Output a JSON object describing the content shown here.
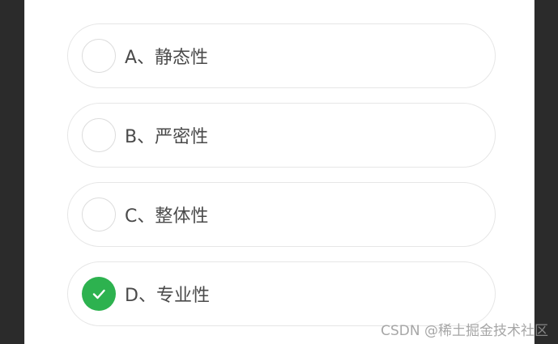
{
  "options": [
    {
      "label": "A、静态性",
      "checked": false
    },
    {
      "label": "B、严密性",
      "checked": false
    },
    {
      "label": "C、整体性",
      "checked": false
    },
    {
      "label": "D、专业性",
      "checked": true
    }
  ],
  "accent_color": "#2db24f",
  "icons": {
    "checked": "checkmark-icon",
    "unchecked": "empty-radio-icon"
  },
  "watermark": "CSDN @稀土掘金技术社区"
}
